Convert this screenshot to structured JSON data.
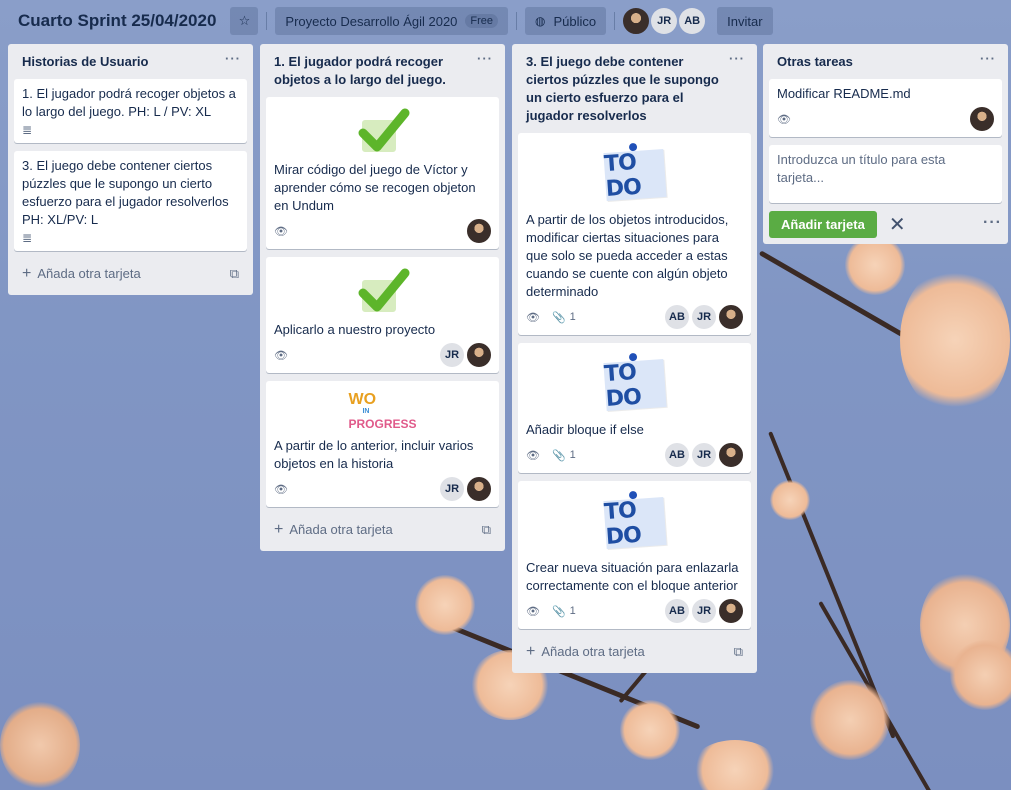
{
  "header": {
    "title": "Cuarto Sprint 25/04/2020",
    "project": "Proyecto Desarrollo Ágil 2020",
    "plan_badge": "Free",
    "visibility": "Público",
    "invite": "Invitar",
    "members": [
      "JR",
      "AB"
    ]
  },
  "lists": [
    {
      "title": "Historias de Usuario",
      "cards": [
        {
          "text": "1. El jugador podrá recoger objetos a lo largo del juego. PH: L / PV: XL"
        },
        {
          "text": "3. El juego debe contener ciertos púzzles que le supongo un cierto esfuerzo para el jugador resolverlos PH: XL/PV: L"
        }
      ],
      "add_label": "Añada otra tarjeta"
    },
    {
      "title": "1. El jugador podrá recoger objetos a lo largo del juego.",
      "cards": [
        {
          "text": "Mirar código del juego de Víctor y aprender cómo se recogen objeton en Undum"
        },
        {
          "text": "Aplicarlo a nuestro proyecto",
          "member": "JR"
        },
        {
          "text": "A partir de lo anterior, incluir varios objetos en la historia",
          "member": "JR",
          "sticker": [
            "WO",
            "IN",
            "PROGRESS"
          ]
        }
      ],
      "add_label": "Añada otra tarjeta"
    },
    {
      "title": "3. El juego debe contener ciertos púzzles que le supongo un cierto esfuerzo para el jugador resolverlos",
      "cards": [
        {
          "text": "A partir de los objetos introducidos, modificar ciertas situaciones para que solo se pueda acceder a estas cuando se cuente con algún objeto determinado",
          "attachments": "1",
          "members": [
            "AB",
            "JR"
          ]
        },
        {
          "text": "Añadir bloque if else",
          "attachments": "1",
          "members": [
            "AB",
            "JR"
          ]
        },
        {
          "text": "Crear nueva situación para enlazarla correctamente con el bloque anterior",
          "attachments": "1",
          "members": [
            "AB",
            "JR"
          ]
        }
      ],
      "sticker_label": "TO DO",
      "add_label": "Añada otra tarjeta"
    },
    {
      "title": "Otras tareas",
      "cards": [
        {
          "text": "Modificar README.md"
        }
      ],
      "composer_placeholder": "Introduzca un título para esta tarjeta...",
      "add_button": "Añadir tarjeta"
    }
  ],
  "colors": {
    "accent_green": "#5aac44",
    "list_bg": "#ebecf0",
    "board_bg": "#8196c4"
  },
  "icons": [
    "star-icon",
    "globe-icon",
    "eye-icon",
    "description-icon",
    "paperclip-icon",
    "template-icon",
    "plus-icon",
    "close-icon"
  ]
}
